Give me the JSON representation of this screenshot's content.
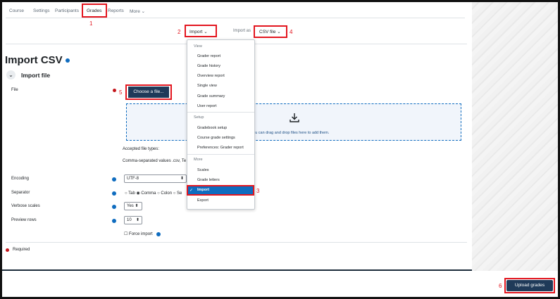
{
  "nav": {
    "items": [
      "Course",
      "Settings",
      "Participants",
      "Grades",
      "Reports",
      "More ⌄"
    ]
  },
  "annotations": [
    "1",
    "2",
    "3",
    "4",
    "5",
    "6"
  ],
  "toolbar": {
    "import_label": "Import ⌄",
    "import_as_label": "Import as",
    "csv_label": "CSV file ⌄"
  },
  "page": {
    "title": "Import CSV",
    "section_title": "Import file",
    "file_label": "File",
    "choose_file": "Choose a file...",
    "drop_text": "You can drag and drop files here to add them.",
    "accepted_types": "Accepted file types:",
    "accepted_values": "Comma-separated values .csv, Te",
    "encoding_label": "Encoding",
    "encoding_value": "UTF-8",
    "separator_label": "Separator",
    "separator_options": "○ Tab ◉ Comma ○ Colon ○ Se",
    "verbose_label": "Verbose scales",
    "verbose_value": "Yes ⬍",
    "preview_label": "Preview rows",
    "preview_value": "10",
    "force_import": "Force import",
    "required": "Required",
    "upload_button": "Upload grades"
  },
  "menu": {
    "view_header": "View",
    "view_items": [
      "Grader report",
      "Grade history",
      "Overview report",
      "Single view",
      "Grade summary",
      "User report"
    ],
    "setup_header": "Setup",
    "setup_items": [
      "Gradebook setup",
      "Course grade settings",
      "Preferences: Grader report"
    ],
    "more_header": "More",
    "more_items": [
      "Scales",
      "Grade letters"
    ],
    "selected_item": "Import",
    "check": "✓",
    "after_item": "Export"
  },
  "colors": {
    "annotation_red": "#e3161f",
    "button_dark": "#1f3a59",
    "accent_blue": "#0f6cbf"
  }
}
